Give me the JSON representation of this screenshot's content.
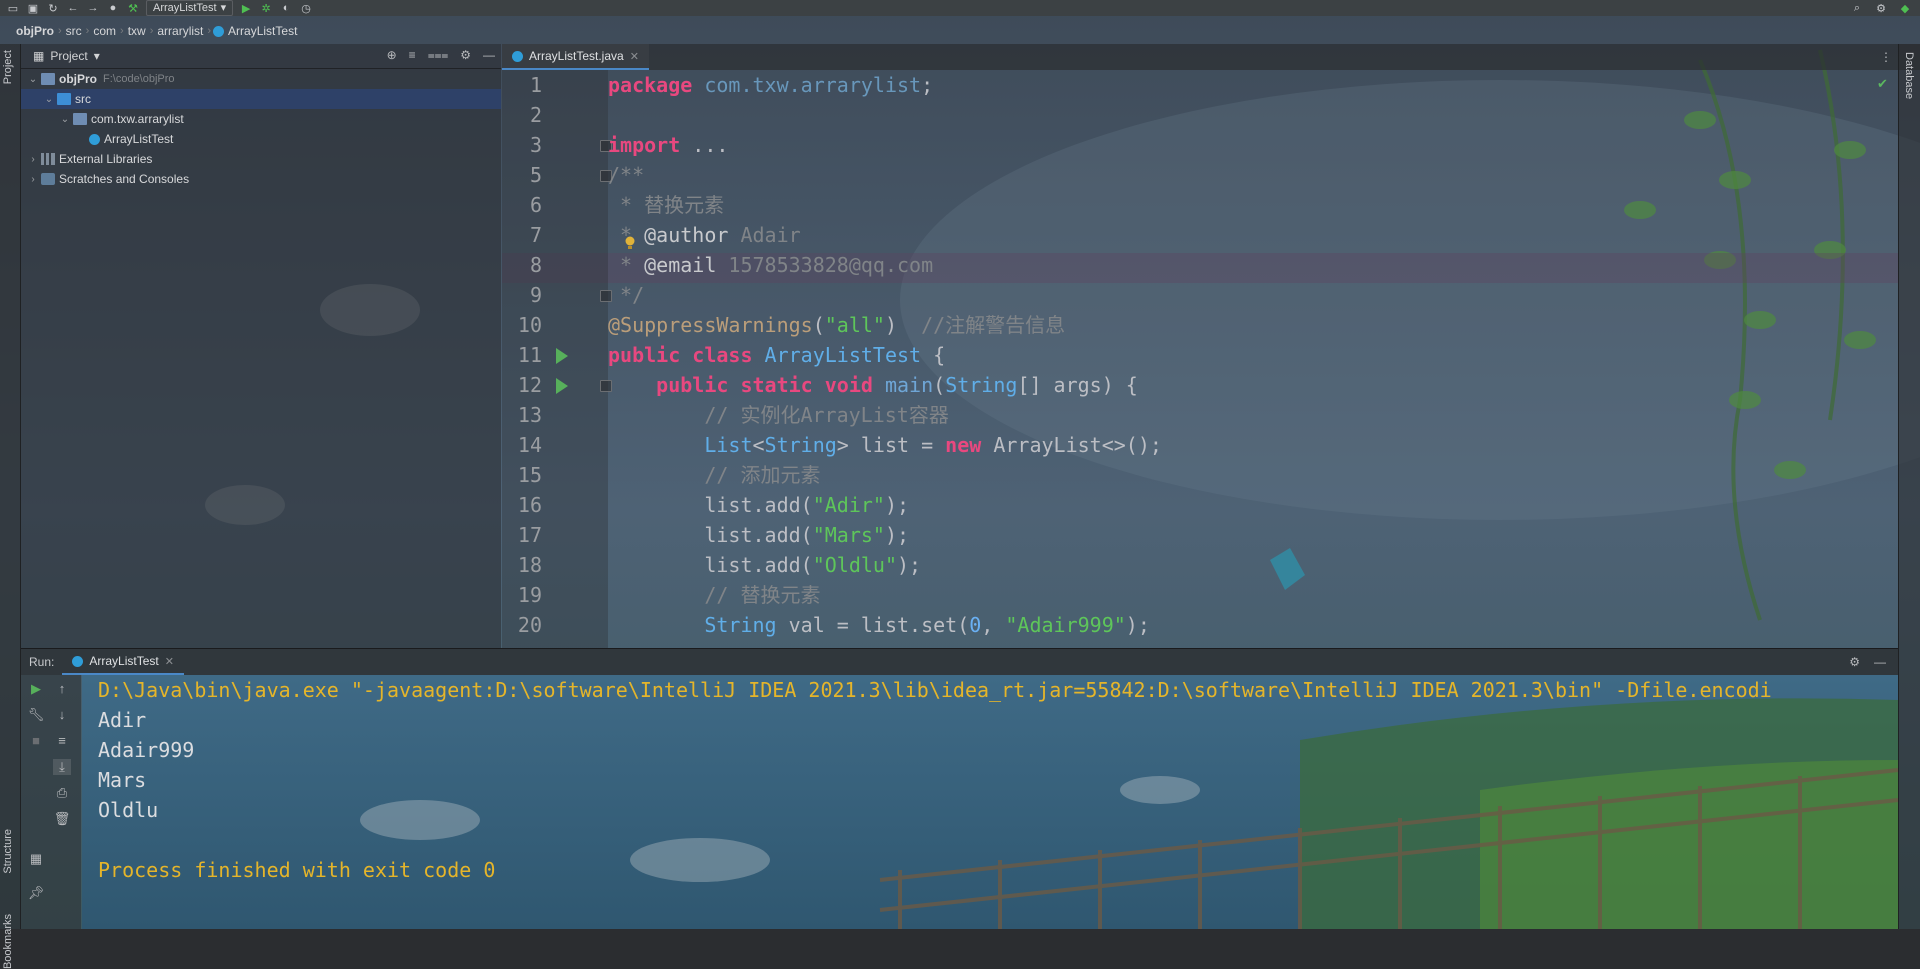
{
  "toolbar": {
    "run_config": "ArrayListTest"
  },
  "navbar": {
    "crumbs": [
      "objPro",
      "src",
      "com",
      "txw",
      "arrarylist",
      "ArrayListTest"
    ]
  },
  "left_strip": {
    "project_tab": "Project",
    "structure_tab": "Structure",
    "bookmarks_tab": "Bookmarks"
  },
  "right_strip": {
    "database_tab": "Database"
  },
  "project_panel": {
    "title": "Project",
    "tree": [
      {
        "label": "objPro",
        "path": "F:\\code\\objPro",
        "type": "module",
        "expanded": true
      },
      {
        "label": "src",
        "type": "src-folder",
        "expanded": true,
        "selected": true
      },
      {
        "label": "com.txw.arrarylist",
        "type": "package",
        "expanded": true
      },
      {
        "label": "ArrayListTest",
        "type": "class"
      },
      {
        "label": "External Libraries",
        "type": "libraries",
        "expanded": false
      },
      {
        "label": "Scratches and Consoles",
        "type": "scratches",
        "expanded": false
      }
    ]
  },
  "editor": {
    "active_tab": "ArrayListTest.java",
    "current_line": 8,
    "line_numbers": [
      "1",
      "2",
      "3",
      "5",
      "6",
      "7",
      "8",
      "9",
      "10",
      "11",
      "12",
      "13",
      "14",
      "15",
      "16",
      "17",
      "18",
      "19",
      "20"
    ],
    "code": {
      "l1": [
        "package",
        " ",
        "com.txw.arrarylist",
        ";"
      ],
      "l3": [
        "import",
        " ..."
      ],
      "l5": "/**",
      "l6": " * 替换元素",
      "l7": [
        " * ",
        "@author",
        " Adair"
      ],
      "l8": [
        " * ",
        "@email",
        " 1578533828@qq.com"
      ],
      "l9": " */",
      "l10": [
        "@SuppressWarnings",
        "(",
        "\"all\"",
        ")  ",
        "//注解警告信息"
      ],
      "l11": [
        "public class",
        " ",
        "ArrayListTest",
        " {"
      ],
      "l12": [
        "    ",
        "public static void",
        " ",
        "main",
        "(",
        "String",
        "[] args) {"
      ],
      "l13": "        // 实例化ArrayList容器",
      "l14": [
        "        ",
        "List",
        "<",
        "String",
        "> list = ",
        "new",
        " ArrayList<>();"
      ],
      "l15": "        // 添加元素",
      "l16": [
        "        list.add(",
        "\"Adir\"",
        ");"
      ],
      "l17": [
        "        list.add(",
        "\"Mars\"",
        ");"
      ],
      "l18": [
        "        list.add(",
        "\"Oldlu\"",
        ");"
      ],
      "l19": "        // 替换元素",
      "l20": [
        "        ",
        "String",
        " val = list.set(",
        "0",
        ", ",
        "\"Adair999\"",
        ");"
      ]
    }
  },
  "run_panel": {
    "label": "Run:",
    "tab": "ArrayListTest",
    "output": [
      "D:\\Java\\bin\\java.exe \"-javaagent:D:\\software\\IntelliJ IDEA 2021.3\\lib\\idea_rt.jar=55842:D:\\software\\IntelliJ IDEA 2021.3\\bin\" -Dfile.encodi",
      "Adir",
      "Adair999",
      "Mars",
      "Oldlu",
      "",
      "Process finished with exit code 0"
    ]
  },
  "icons": {
    "toolbar": [
      "open-icon",
      "save-icon",
      "sync-icon",
      "back-icon",
      "forward-icon",
      "user-icon",
      "build-icon",
      "run-icon",
      "debug-icon",
      "coverage-icon",
      "profile-icon",
      "search-icon",
      "settings-icon",
      "update-icon"
    ],
    "project_actions": [
      "locate-icon",
      "expand-all-icon",
      "collapse-all-icon",
      "gear-icon",
      "minimize-icon"
    ]
  },
  "colors": {
    "keyword": "#e8487f",
    "string": "#5ec65a",
    "comment": "#808488",
    "console_system": "#e5b52a",
    "selection": "#2e436e",
    "tab_underline": "#4a88c7"
  }
}
